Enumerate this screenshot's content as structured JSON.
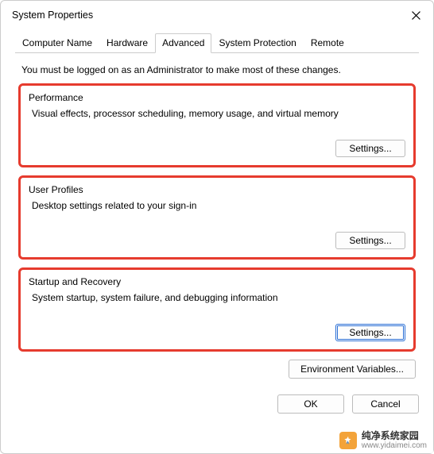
{
  "window": {
    "title": "System Properties"
  },
  "tabs": {
    "items": [
      {
        "label": "Computer Name"
      },
      {
        "label": "Hardware"
      },
      {
        "label": "Advanced"
      },
      {
        "label": "System Protection"
      },
      {
        "label": "Remote"
      }
    ],
    "active_index": 2
  },
  "admin_note": "You must be logged on as an Administrator to make most of these changes.",
  "groups": {
    "performance": {
      "title": "Performance",
      "description": "Visual effects, processor scheduling, memory usage, and virtual memory",
      "button": "Settings..."
    },
    "user_profiles": {
      "title": "User Profiles",
      "description": "Desktop settings related to your sign-in",
      "button": "Settings..."
    },
    "startup_recovery": {
      "title": "Startup and Recovery",
      "description": "System startup, system failure, and debugging information",
      "button": "Settings..."
    }
  },
  "env_button": "Environment Variables...",
  "bottom": {
    "ok": "OK",
    "cancel": "Cancel"
  },
  "watermark": {
    "line1": "纯净系统家园",
    "line2": "www.yidaimei.com"
  }
}
